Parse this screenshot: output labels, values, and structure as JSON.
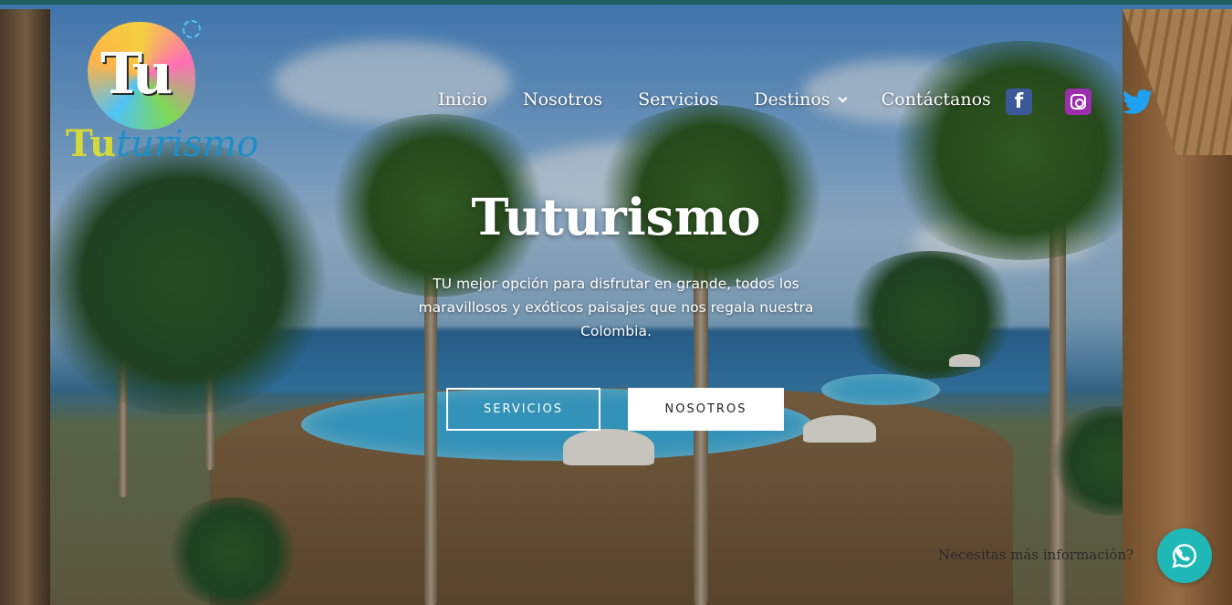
{
  "brand": {
    "logo_mark": "Tu",
    "logo_text_a": "Tu",
    "logo_text_b": "turismo"
  },
  "nav": {
    "items": [
      {
        "label": "Inicio"
      },
      {
        "label": "Nosotros"
      },
      {
        "label": "Servicios"
      },
      {
        "label": "Destinos",
        "has_dropdown": true
      },
      {
        "label": "Contáctanos"
      }
    ]
  },
  "social": {
    "icons": [
      "facebook-icon",
      "instagram-icon",
      "twitter-icon"
    ],
    "facebook_glyph": "f"
  },
  "hero": {
    "title": "Tuturismo",
    "subtitle": "TU mejor opción para disfrutar en grande, todos los maravillosos y exóticos paisajes que nos regala nuestra Colombia.",
    "buttons": {
      "primary": "SERVICIOS",
      "secondary": "NOSOTROS"
    }
  },
  "chat": {
    "prompt": "Necesitas más información?",
    "icon": "whatsapp-icon"
  },
  "colors": {
    "topbar": "#1f5c5c",
    "whatsapp": "#20b7b7",
    "facebook": "#3b5998",
    "instagram": "#9b2fae",
    "twitter": "#1da1f2"
  }
}
